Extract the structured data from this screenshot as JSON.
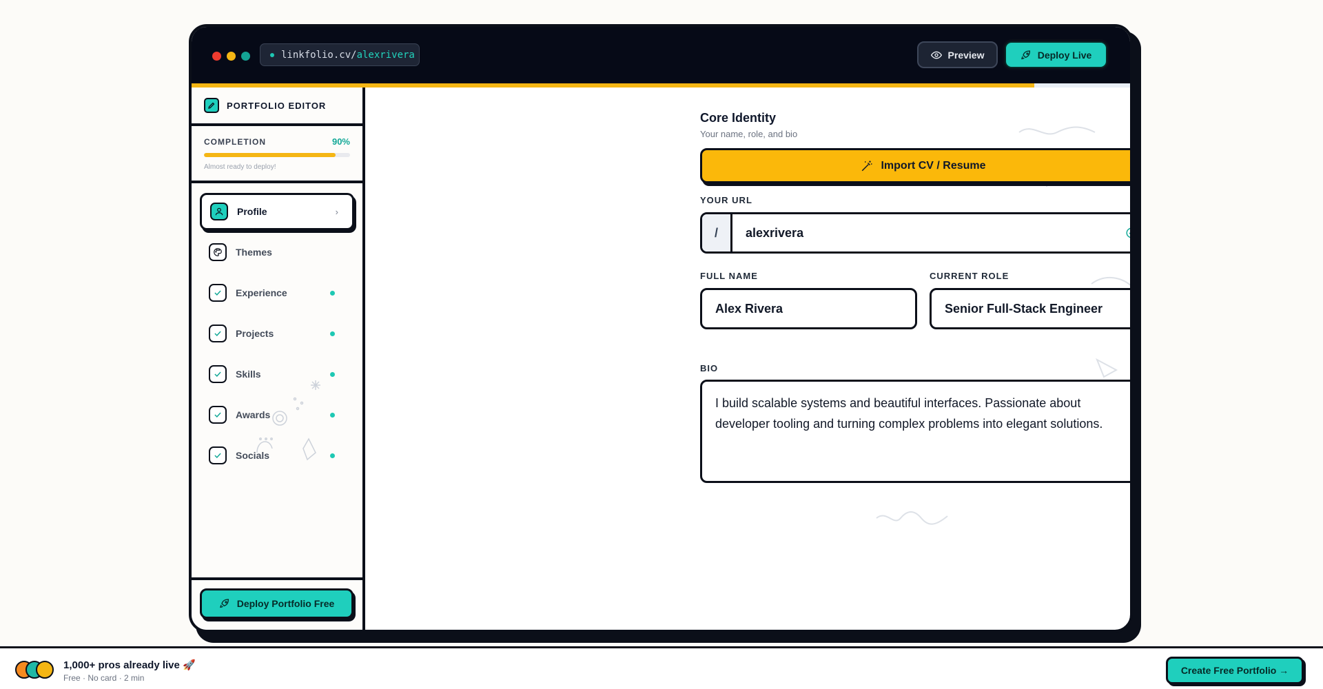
{
  "window": {
    "url_domain": "linkfolio.cv/",
    "url_slug": "alexrivera",
    "preview_label": "Preview",
    "deploy_live_label": "Deploy Live"
  },
  "sidebar": {
    "title": "PORTFOLIO EDITOR",
    "completion_label": "COMPLETION",
    "completion_value": "90%",
    "completion_fraction": 0.9,
    "completion_note": "Almost ready to deploy!",
    "items": [
      {
        "label": "Profile",
        "icon": "user-icon",
        "active": true,
        "done": false
      },
      {
        "label": "Themes",
        "icon": "palette-icon",
        "active": false,
        "done": false
      },
      {
        "label": "Experience",
        "icon": "check-icon",
        "active": false,
        "done": true
      },
      {
        "label": "Projects",
        "icon": "check-icon",
        "active": false,
        "done": true
      },
      {
        "label": "Skills",
        "icon": "check-icon",
        "active": false,
        "done": true
      },
      {
        "label": "Awards",
        "icon": "check-icon",
        "active": false,
        "done": true
      },
      {
        "label": "Socials",
        "icon": "check-icon",
        "active": false,
        "done": true
      }
    ],
    "deploy_button_label": "Deploy Portfolio Free"
  },
  "content": {
    "section_title": "Core Identity",
    "section_subtitle": "Your name, role, and bio",
    "import_label": "Import CV / Resume",
    "url_label": "YOUR URL",
    "url_prefix": "/",
    "url_value": "alexrivera",
    "full_name_label": "FULL NAME",
    "full_name_value": "Alex Rivera",
    "role_label": "CURRENT ROLE",
    "role_value": "Senior Full-Stack Engineer",
    "bio_label": "BIO",
    "bio_value": "I build scalable systems and beautiful interfaces. Passionate about developer tooling and turning complex problems into elegant solutions."
  },
  "bottom_bar": {
    "proof_title": "1,000+ pros already live 🚀",
    "proof_subtitle": "Free · No card · 2 min",
    "cta_label": "Create Free Portfolio →"
  },
  "colors": {
    "accent": "#1fcfbd",
    "warning": "#fbb80a",
    "ink": "#0b0f19"
  }
}
